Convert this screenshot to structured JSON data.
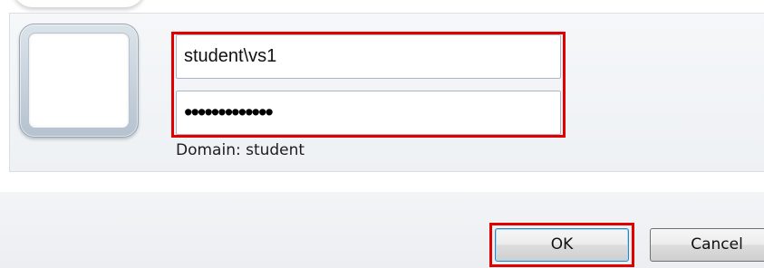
{
  "credentials": {
    "username_value": "student\\vs1",
    "password_value": "•••••••••••••",
    "domain_text": "Domain: student"
  },
  "buttons": {
    "ok_label": "OK",
    "cancel_label": "Cancel"
  },
  "colors": {
    "highlight": "#e00000",
    "panel_background": "#eef1f4",
    "default_button_border": "#3c7fb1"
  },
  "icons": {
    "user_tile": "user-picture-tile"
  }
}
